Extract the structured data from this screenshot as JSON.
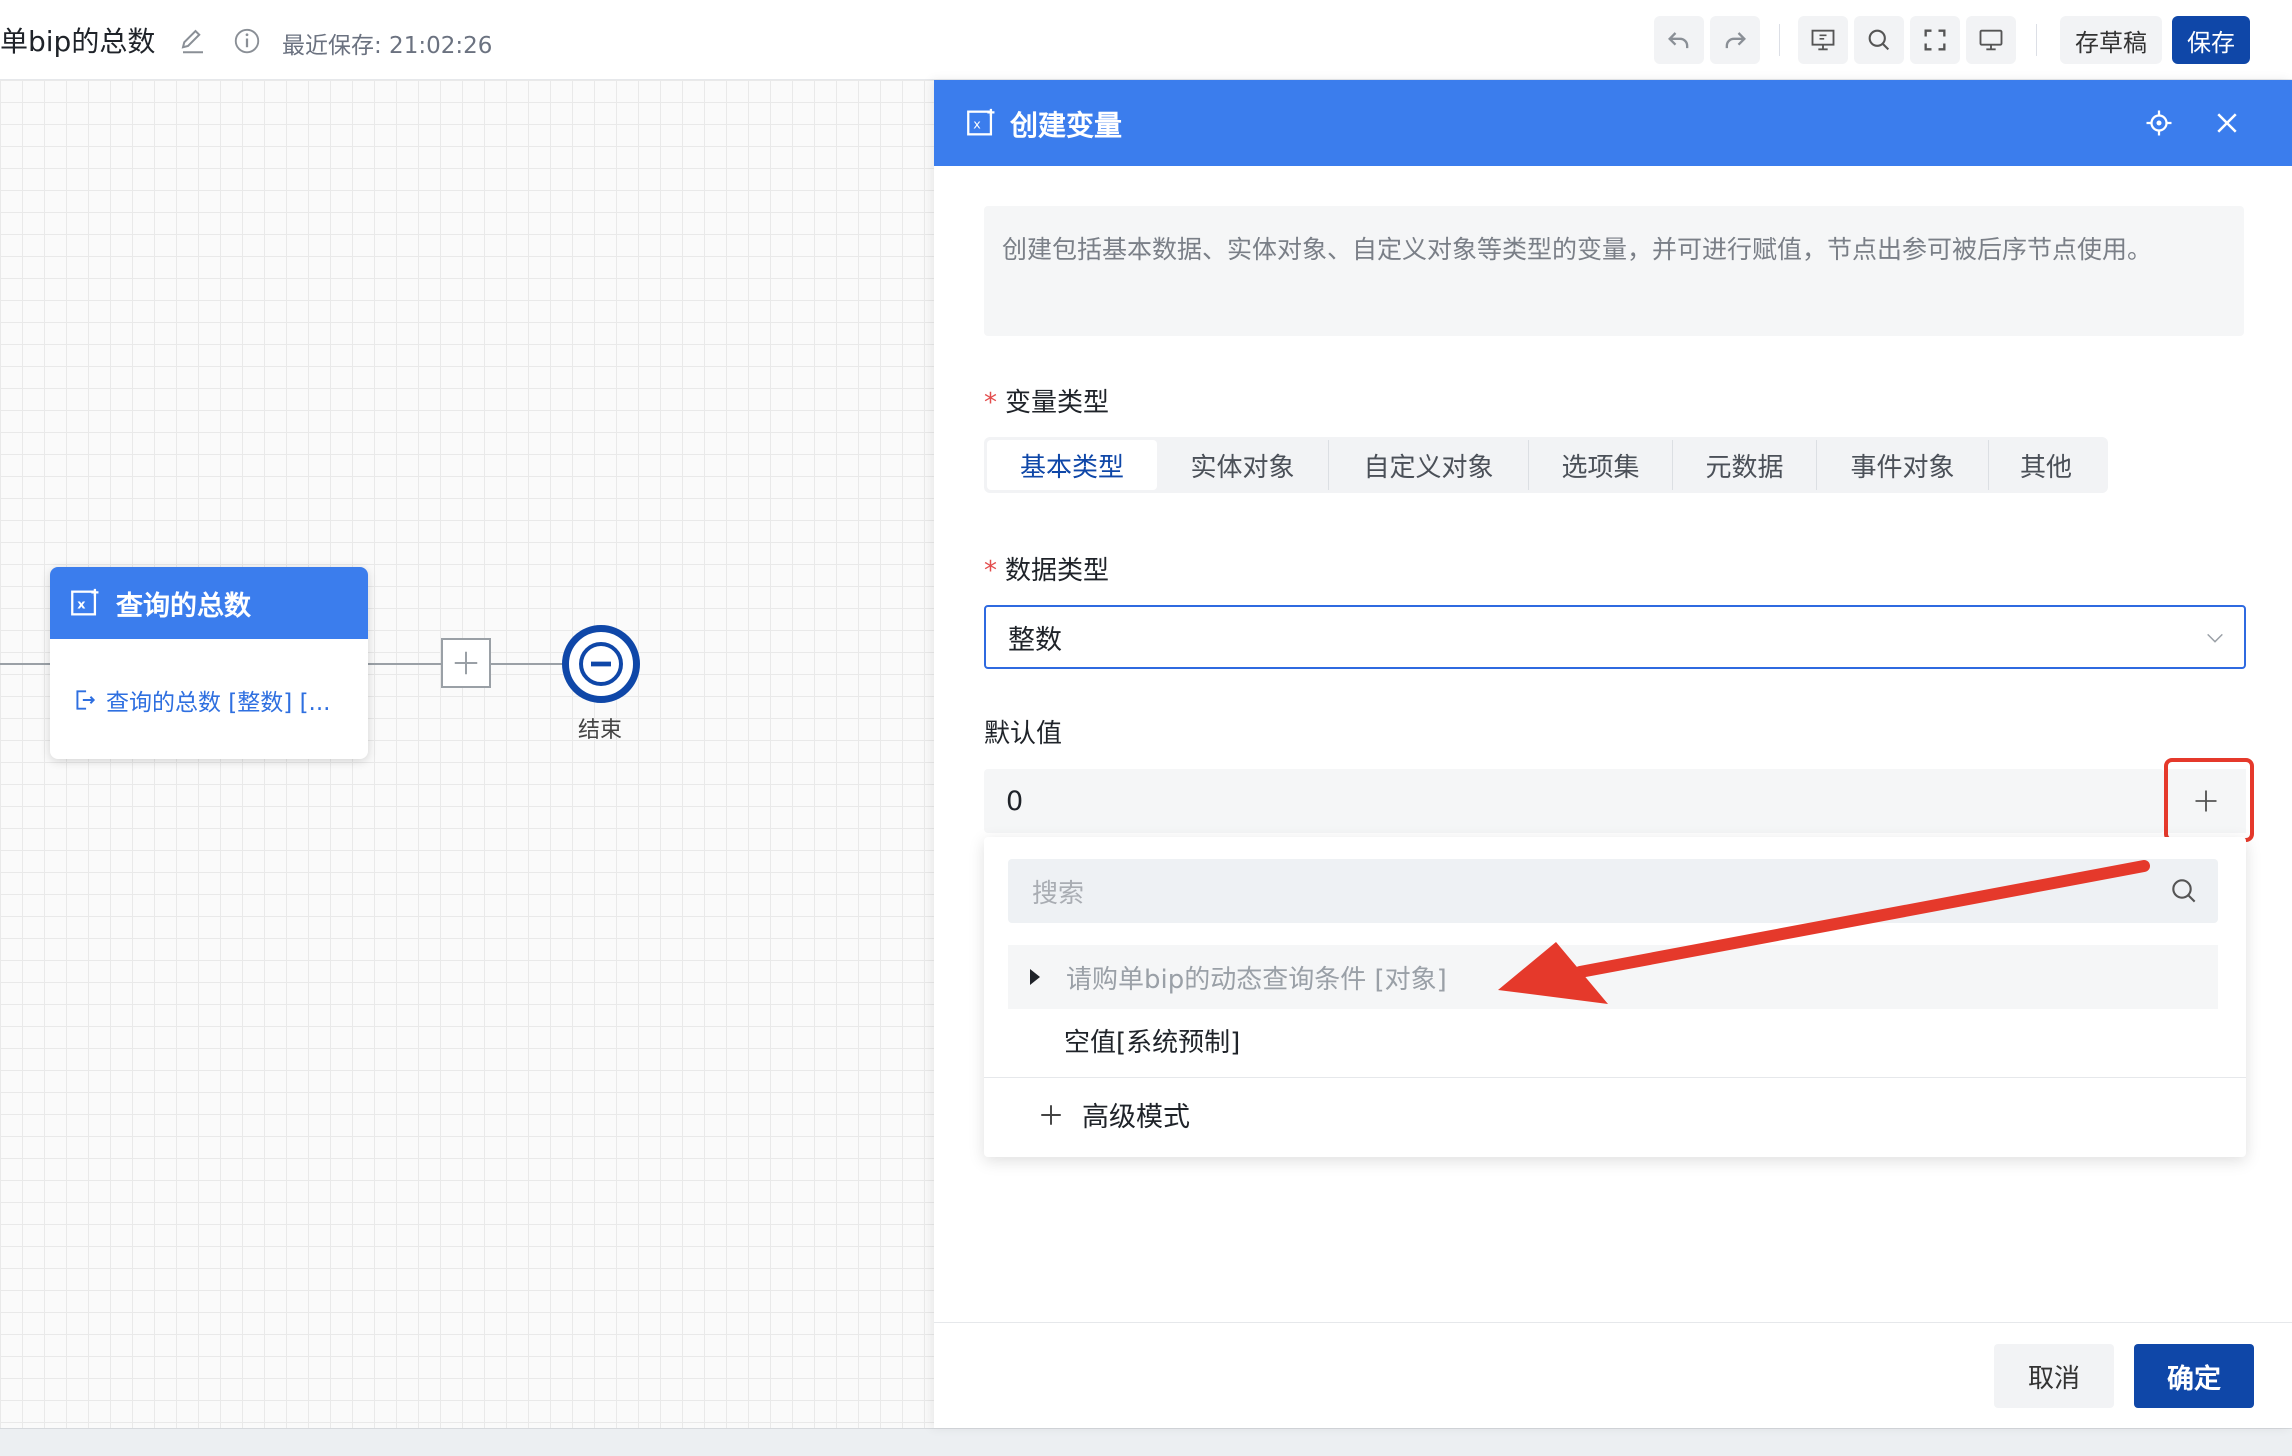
{
  "header": {
    "title": "单bip的总数",
    "last_saved": "最近保存: 21:02:26",
    "draft_button": "存草稿",
    "save_button": "保存",
    "toolbar_icons": [
      "undo-icon",
      "redo-icon",
      "preview-icon",
      "search-icon",
      "fullscreen-icon",
      "monitor-icon"
    ]
  },
  "canvas": {
    "node": {
      "title": "查询的总数",
      "output": "查询的总数 [整数] [..."
    },
    "end_label": "结束"
  },
  "drawer": {
    "title": "创建变量",
    "description": "创建包括基本数据、实体对象、自定义对象等类型的变量，并可进行赋值，节点出参可被后序节点使用。",
    "variable_type_label": "变量类型",
    "variable_types": [
      "基本类型",
      "实体对象",
      "自定义对象",
      "选项集",
      "元数据",
      "事件对象",
      "其他"
    ],
    "active_type": "基本类型",
    "data_type_label": "数据类型",
    "data_type_value": "整数",
    "default_value_label": "默认值",
    "default_value": "0",
    "dropdown": {
      "search_placeholder": "搜索",
      "items": [
        "请购单bip的动态查询条件 [对象]",
        "空值[系统预制]"
      ],
      "advanced": "高级模式"
    },
    "cancel_button": "取消",
    "confirm_button": "确定"
  },
  "colors": {
    "header_blue": "#3b7ded",
    "primary_dark": "#0f47a8",
    "highlight_red": "#e5392b"
  }
}
